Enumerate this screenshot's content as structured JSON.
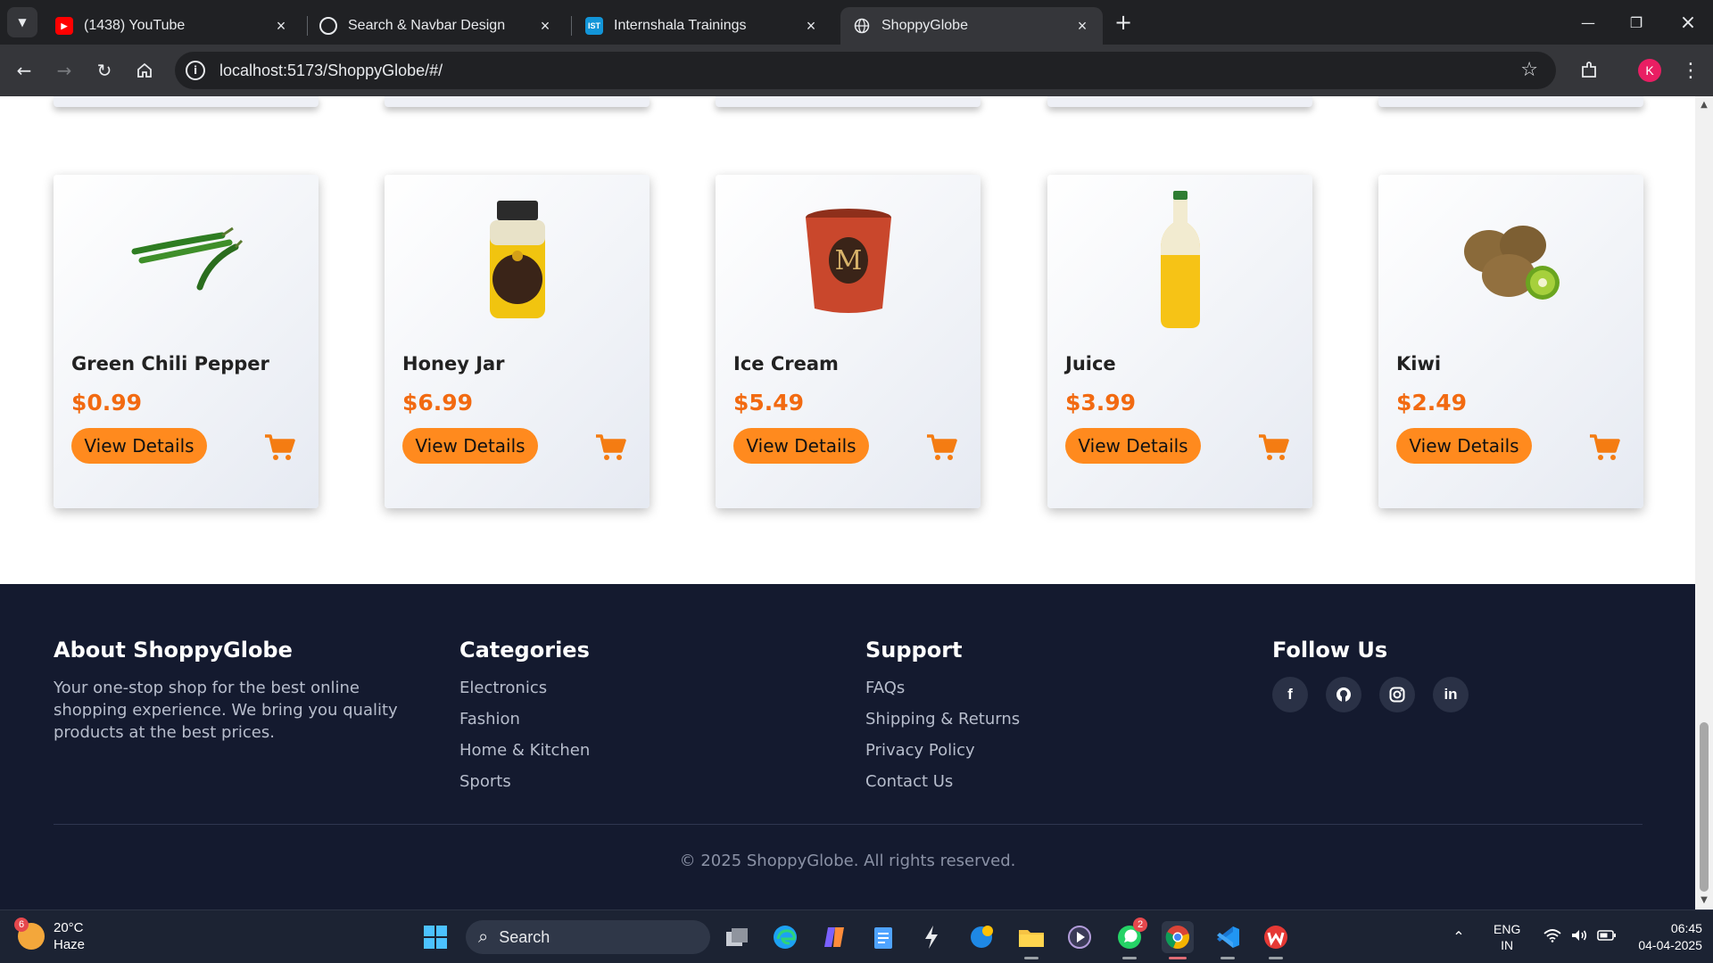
{
  "browser": {
    "tabs": [
      {
        "label": "(1438) YouTube",
        "icon": "youtube-icon"
      },
      {
        "label": "Search & Navbar Design",
        "icon": "openai-icon"
      },
      {
        "label": "Internshala Trainings",
        "icon": "internshala-icon",
        "icon_text": "IST"
      },
      {
        "label": "ShoppyGlobe",
        "icon": "globe-icon",
        "active": true
      }
    ],
    "url": "localhost:5173/ShoppyGlobe/#/",
    "profile_initial": "K"
  },
  "products": [
    {
      "name": "Green Chili Pepper",
      "price": "$0.99",
      "button": "View Details",
      "image": "chili-pepper"
    },
    {
      "name": "Honey Jar",
      "price": "$6.99",
      "button": "View Details",
      "image": "honey-jar"
    },
    {
      "name": "Ice Cream",
      "price": "$5.49",
      "button": "View Details",
      "image": "ice-cream-tub"
    },
    {
      "name": "Juice",
      "price": "$3.99",
      "button": "View Details",
      "image": "juice-bottle"
    },
    {
      "name": "Kiwi",
      "price": "$2.49",
      "button": "View Details",
      "image": "kiwi"
    }
  ],
  "footer": {
    "about": {
      "title": "About ShoppyGlobe",
      "text": "Your one-stop shop for the best online shopping experience. We bring you quality products at the best prices."
    },
    "categories": {
      "title": "Categories",
      "items": [
        "Electronics",
        "Fashion",
        "Home & Kitchen",
        "Sports"
      ]
    },
    "support": {
      "title": "Support",
      "items": [
        "FAQs",
        "Shipping & Returns",
        "Privacy Policy",
        "Contact Us"
      ]
    },
    "follow": {
      "title": "Follow Us",
      "icons": [
        "facebook-icon",
        "github-icon",
        "instagram-icon",
        "linkedin-icon"
      ]
    },
    "copyright": "© 2025 ShoppyGlobe. All rights reserved."
  },
  "taskbar": {
    "weather_temp": "20°C",
    "weather_desc": "Haze",
    "weather_badge": "6",
    "search_label": "Search",
    "whatsapp_badge": "2",
    "lang_top": "ENG",
    "lang_bottom": "IN",
    "time": "06:45",
    "date": "04-04-2025"
  },
  "colors": {
    "accent": "#ff8a1e",
    "price": "#f26a11",
    "footer_bg": "#141a2f"
  }
}
